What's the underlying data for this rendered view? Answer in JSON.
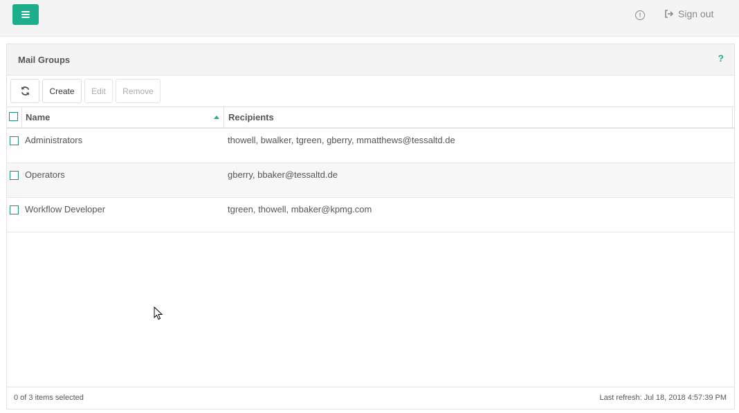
{
  "topbar": {
    "menu_icon": "hamburger-icon",
    "info_icon": "info-icon",
    "signout_label": "Sign out",
    "signout_icon": "sign-out-icon",
    "accent_color": "#1fae8c"
  },
  "panel": {
    "title": "Mail Groups",
    "help_label": "?"
  },
  "toolbar": {
    "refresh_icon": "refresh-icon",
    "create_label": "Create",
    "edit_label": "Edit",
    "remove_label": "Remove"
  },
  "grid": {
    "columns": [
      {
        "label": "Name",
        "sorted": "ascending"
      },
      {
        "label": "Recipients"
      }
    ],
    "rows": [
      {
        "name": "Administrators",
        "recipients": "thowell, bwalker, tgreen, gberry, mmatthews@tessaltd.de"
      },
      {
        "name": "Operators",
        "recipients": "gberry, bbaker@tessaltd.de"
      },
      {
        "name": "Workflow Developer",
        "recipients": "tgreen, thowell, mbaker@kpmg.com"
      }
    ]
  },
  "footer": {
    "selection_text": "0 of 3 items selected",
    "last_refresh": "Last refresh: Jul 18, 2018 4:57:39 PM"
  }
}
